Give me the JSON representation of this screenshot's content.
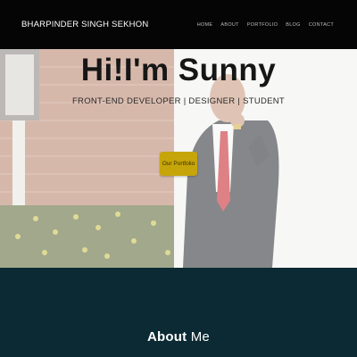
{
  "nav": {
    "brand": "BHARPINDER SINGH SEKHON",
    "links": [
      "HOME",
      "ABOUT",
      "PORTFOLIO",
      "BLOG",
      "CONTACT"
    ]
  },
  "hero": {
    "title": "Hi!I'm Sunny",
    "subtitle": "FRONT-END DEVELOPER | DESIGNER | STUDENT",
    "button_label": "Our Portfolio"
  },
  "about": {
    "heading_bold": "About",
    "heading_light": "Me"
  },
  "colors": {
    "navbar": "#050505",
    "accent_button": "#c6a50a",
    "about_bg": "#0b2a33"
  }
}
